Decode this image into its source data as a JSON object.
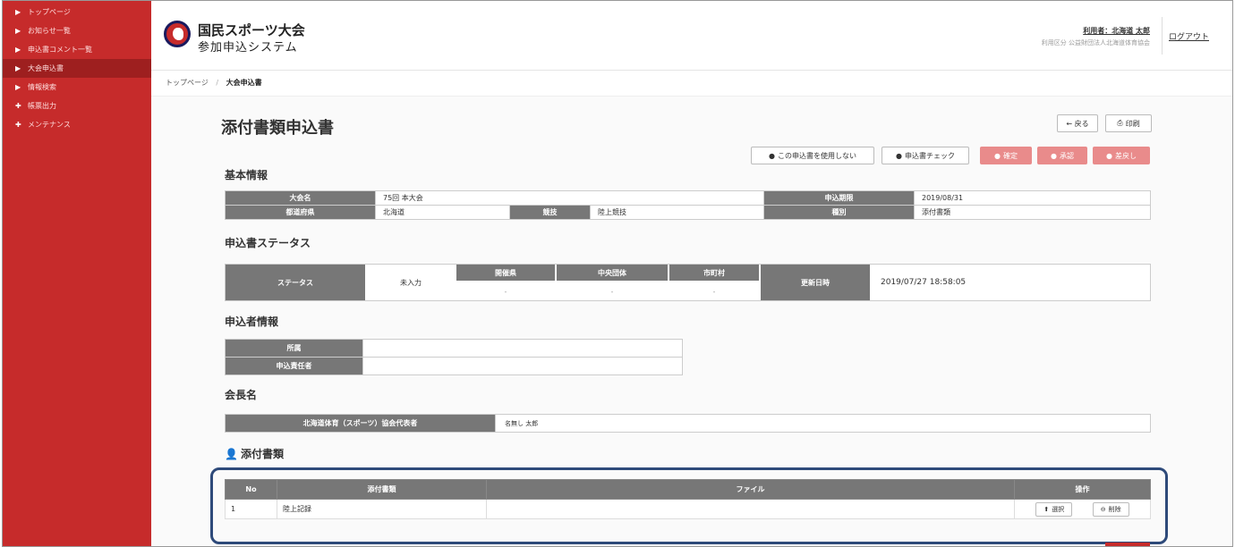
{
  "sidebar": {
    "items": [
      {
        "label": "トップページ"
      },
      {
        "label": "お知らせ一覧"
      },
      {
        "label": "申込書コメント一覧"
      },
      {
        "label": "大会申込書"
      },
      {
        "label": "情報検索"
      },
      {
        "label": "帳票出力"
      },
      {
        "label": "メンテナンス"
      }
    ]
  },
  "header": {
    "brand_line1": "国民スポーツ大会",
    "brand_line2": "参加申込システム",
    "user": "利用者：北海道 太郎",
    "user_division": "利用区分 公益財団法人北海道体育協会",
    "logout": "ログアウト"
  },
  "breadcrumb": {
    "home": "トップページ",
    "sep": "/",
    "current": "大会申込書"
  },
  "page": {
    "title": "添付書類申込書",
    "back": "← 戻る",
    "print": "印刷"
  },
  "actions": {
    "not_use": "この申込書を使用しない",
    "check": "申込書チェック",
    "confirm": "確定",
    "approve": "承認",
    "return": "差戻し"
  },
  "basic": {
    "title": "基本情報",
    "taikai_label": "大会名",
    "taikai_value": "75回 本大会",
    "deadline_label": "申込期限",
    "deadline_value": "2019/08/31",
    "pref_label": "都道府県",
    "pref_value": "北海道",
    "sport_label": "競技",
    "sport_value": "陸上競技",
    "type_label": "種別",
    "type_value": "添付書類"
  },
  "status": {
    "title": "申込書ステータス",
    "status_label": "ステータス",
    "status_value": "未入力",
    "kaisai_label": "開催県",
    "kaisai_value": "-",
    "chuo_label": "中央団体",
    "chuo_value": "-",
    "city_label": "市町村",
    "city_value": "-",
    "updated_label": "更新日時",
    "updated_value": "2019/07/27 18:58:05"
  },
  "applicant": {
    "title": "申込者情報",
    "affil_label": "所属",
    "affil_value": "",
    "resp_label": "申込責任者",
    "resp_value": ""
  },
  "chairman": {
    "title": "会長名",
    "label": "北海道体育（スポーツ）協会代表者",
    "value": "名無し 太郎"
  },
  "attachments": {
    "title": "添付書類",
    "columns": [
      "No",
      "添付書類",
      "ファイル",
      "操作"
    ],
    "rows": [
      {
        "no": "1",
        "name": "陸上記録",
        "file": ""
      }
    ],
    "select": "選択",
    "delete": "削除"
  }
}
